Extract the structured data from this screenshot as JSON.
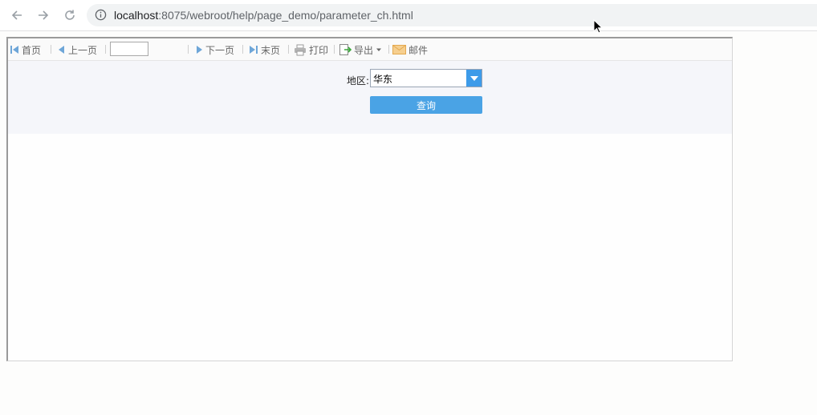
{
  "browser": {
    "url_host": "localhost",
    "url_path": ":8075/webroot/help/page_demo/parameter_ch.html"
  },
  "toolbar": {
    "first_label": "首页",
    "prev_label": "上一页",
    "page_value": "",
    "next_label": "下一页",
    "last_label": "末页",
    "print_label": "打印",
    "export_label": "导出",
    "email_label": "邮件"
  },
  "params": {
    "region_label": "地区:",
    "region_value": "华东",
    "query_label": "查询"
  },
  "colors": {
    "accent": "#4aa3e5",
    "combo_button": "#3d9be9"
  },
  "icons": [
    "back-arrow-icon",
    "forward-arrow-icon",
    "reload-icon",
    "info-icon",
    "first-page-icon",
    "prev-page-icon",
    "next-page-icon",
    "last-page-icon",
    "printer-icon",
    "export-icon",
    "chevron-down-icon",
    "mail-icon",
    "mouse-cursor-icon"
  ]
}
